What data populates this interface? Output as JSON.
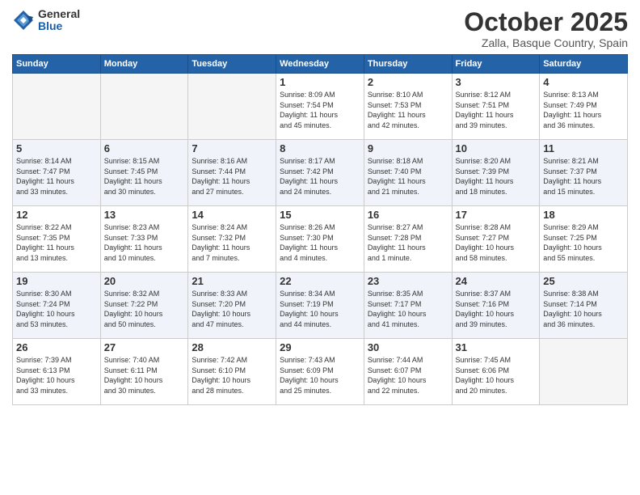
{
  "logo": {
    "general": "General",
    "blue": "Blue"
  },
  "title": "October 2025",
  "subtitle": "Zalla, Basque Country, Spain",
  "headers": [
    "Sunday",
    "Monday",
    "Tuesday",
    "Wednesday",
    "Thursday",
    "Friday",
    "Saturday"
  ],
  "weeks": [
    [
      {
        "day": "",
        "info": ""
      },
      {
        "day": "",
        "info": ""
      },
      {
        "day": "",
        "info": ""
      },
      {
        "day": "1",
        "info": "Sunrise: 8:09 AM\nSunset: 7:54 PM\nDaylight: 11 hours\nand 45 minutes."
      },
      {
        "day": "2",
        "info": "Sunrise: 8:10 AM\nSunset: 7:53 PM\nDaylight: 11 hours\nand 42 minutes."
      },
      {
        "day": "3",
        "info": "Sunrise: 8:12 AM\nSunset: 7:51 PM\nDaylight: 11 hours\nand 39 minutes."
      },
      {
        "day": "4",
        "info": "Sunrise: 8:13 AM\nSunset: 7:49 PM\nDaylight: 11 hours\nand 36 minutes."
      }
    ],
    [
      {
        "day": "5",
        "info": "Sunrise: 8:14 AM\nSunset: 7:47 PM\nDaylight: 11 hours\nand 33 minutes."
      },
      {
        "day": "6",
        "info": "Sunrise: 8:15 AM\nSunset: 7:45 PM\nDaylight: 11 hours\nand 30 minutes."
      },
      {
        "day": "7",
        "info": "Sunrise: 8:16 AM\nSunset: 7:44 PM\nDaylight: 11 hours\nand 27 minutes."
      },
      {
        "day": "8",
        "info": "Sunrise: 8:17 AM\nSunset: 7:42 PM\nDaylight: 11 hours\nand 24 minutes."
      },
      {
        "day": "9",
        "info": "Sunrise: 8:18 AM\nSunset: 7:40 PM\nDaylight: 11 hours\nand 21 minutes."
      },
      {
        "day": "10",
        "info": "Sunrise: 8:20 AM\nSunset: 7:39 PM\nDaylight: 11 hours\nand 18 minutes."
      },
      {
        "day": "11",
        "info": "Sunrise: 8:21 AM\nSunset: 7:37 PM\nDaylight: 11 hours\nand 15 minutes."
      }
    ],
    [
      {
        "day": "12",
        "info": "Sunrise: 8:22 AM\nSunset: 7:35 PM\nDaylight: 11 hours\nand 13 minutes."
      },
      {
        "day": "13",
        "info": "Sunrise: 8:23 AM\nSunset: 7:33 PM\nDaylight: 11 hours\nand 10 minutes."
      },
      {
        "day": "14",
        "info": "Sunrise: 8:24 AM\nSunset: 7:32 PM\nDaylight: 11 hours\nand 7 minutes."
      },
      {
        "day": "15",
        "info": "Sunrise: 8:26 AM\nSunset: 7:30 PM\nDaylight: 11 hours\nand 4 minutes."
      },
      {
        "day": "16",
        "info": "Sunrise: 8:27 AM\nSunset: 7:28 PM\nDaylight: 11 hours\nand 1 minute."
      },
      {
        "day": "17",
        "info": "Sunrise: 8:28 AM\nSunset: 7:27 PM\nDaylight: 10 hours\nand 58 minutes."
      },
      {
        "day": "18",
        "info": "Sunrise: 8:29 AM\nSunset: 7:25 PM\nDaylight: 10 hours\nand 55 minutes."
      }
    ],
    [
      {
        "day": "19",
        "info": "Sunrise: 8:30 AM\nSunset: 7:24 PM\nDaylight: 10 hours\nand 53 minutes."
      },
      {
        "day": "20",
        "info": "Sunrise: 8:32 AM\nSunset: 7:22 PM\nDaylight: 10 hours\nand 50 minutes."
      },
      {
        "day": "21",
        "info": "Sunrise: 8:33 AM\nSunset: 7:20 PM\nDaylight: 10 hours\nand 47 minutes."
      },
      {
        "day": "22",
        "info": "Sunrise: 8:34 AM\nSunset: 7:19 PM\nDaylight: 10 hours\nand 44 minutes."
      },
      {
        "day": "23",
        "info": "Sunrise: 8:35 AM\nSunset: 7:17 PM\nDaylight: 10 hours\nand 41 minutes."
      },
      {
        "day": "24",
        "info": "Sunrise: 8:37 AM\nSunset: 7:16 PM\nDaylight: 10 hours\nand 39 minutes."
      },
      {
        "day": "25",
        "info": "Sunrise: 8:38 AM\nSunset: 7:14 PM\nDaylight: 10 hours\nand 36 minutes."
      }
    ],
    [
      {
        "day": "26",
        "info": "Sunrise: 7:39 AM\nSunset: 6:13 PM\nDaylight: 10 hours\nand 33 minutes."
      },
      {
        "day": "27",
        "info": "Sunrise: 7:40 AM\nSunset: 6:11 PM\nDaylight: 10 hours\nand 30 minutes."
      },
      {
        "day": "28",
        "info": "Sunrise: 7:42 AM\nSunset: 6:10 PM\nDaylight: 10 hours\nand 28 minutes."
      },
      {
        "day": "29",
        "info": "Sunrise: 7:43 AM\nSunset: 6:09 PM\nDaylight: 10 hours\nand 25 minutes."
      },
      {
        "day": "30",
        "info": "Sunrise: 7:44 AM\nSunset: 6:07 PM\nDaylight: 10 hours\nand 22 minutes."
      },
      {
        "day": "31",
        "info": "Sunrise: 7:45 AM\nSunset: 6:06 PM\nDaylight: 10 hours\nand 20 minutes."
      },
      {
        "day": "",
        "info": ""
      }
    ]
  ]
}
